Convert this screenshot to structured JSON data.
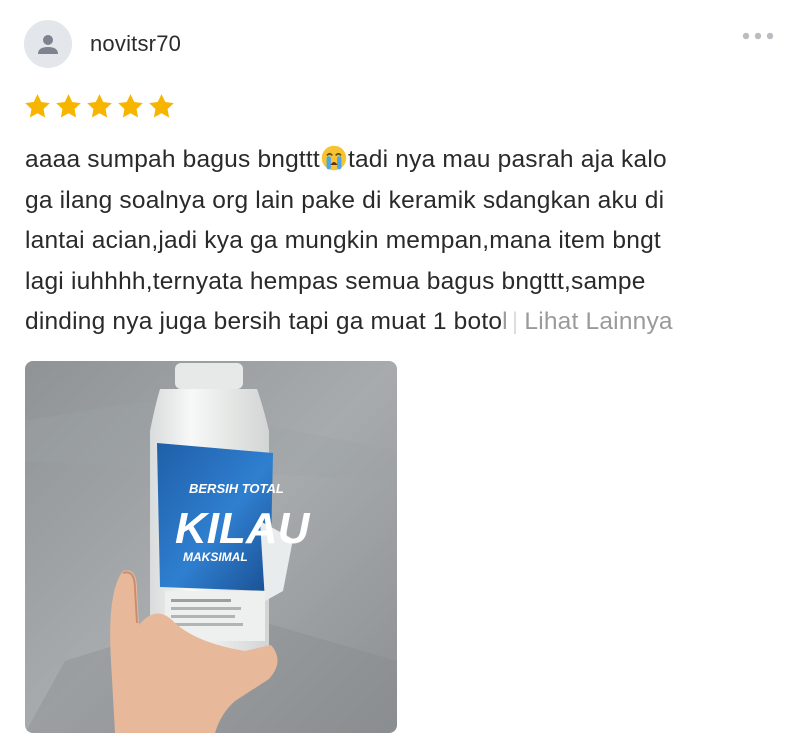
{
  "review": {
    "username": "novitsr70",
    "rating": 5,
    "rating_max": 5,
    "text_lines": [
      {
        "before": "aaaa sumpah bagus bngttt",
        "after": "tadi nya mau pasrah aja kalo"
      },
      {
        "text": "ga ilang soalnya org lain pake di keramik sdangkan aku di"
      },
      {
        "text": "lantai acian,jadi kya ga mungkin mempan,mana item bngt"
      },
      {
        "text": "lagi iuhhhh,ternyata hempas semua bagus bngttt,sampe"
      },
      {
        "visible": "dinding nya juga bersih tapi ga muat 1 boto",
        "faded": "l"
      }
    ],
    "emoji": "loudly-crying-face",
    "more_separator": "|",
    "more_label": "Lihat Lainnya"
  },
  "product_photo": {
    "label_lines": [
      "BERSIH TOTAL",
      "KILAU",
      "MAKSIMAL"
    ]
  },
  "colors": {
    "star": "#f7b500",
    "avatar_bg": "#e3e6ea",
    "avatar_icon": "#7d8490",
    "text": "#2a2a2a",
    "muted": "#9a9a9a",
    "label_blue": "#1f5fa8"
  }
}
